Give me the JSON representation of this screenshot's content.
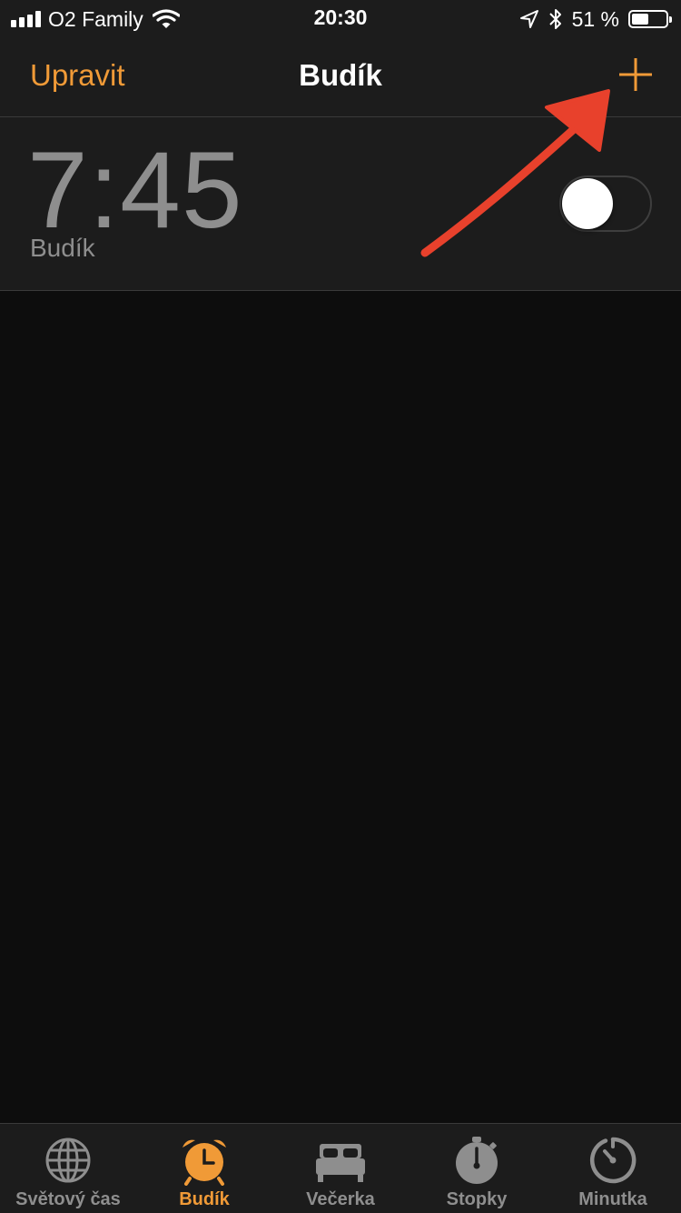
{
  "status_bar": {
    "carrier": "O2 Family",
    "time": "20:30",
    "battery_percent": "51 %",
    "battery_level": 0.51,
    "icons": [
      "signal-icon",
      "wifi-icon",
      "location-icon",
      "bluetooth-icon",
      "battery-icon"
    ]
  },
  "nav": {
    "edit_label": "Upravit",
    "title": "Budík",
    "add_icon": "plus-icon"
  },
  "alarm": {
    "time": "7:45",
    "label": "Budík",
    "enabled": false
  },
  "annotation": {
    "color": "#e8412c",
    "shape": "arrow"
  },
  "tabs": [
    {
      "label": "Světový čas",
      "icon": "globe-icon",
      "active": false
    },
    {
      "label": "Budík",
      "icon": "alarm-clock-icon",
      "active": true
    },
    {
      "label": "Večerka",
      "icon": "bed-icon",
      "active": false
    },
    {
      "label": "Stopky",
      "icon": "stopwatch-icon",
      "active": false
    },
    {
      "label": "Minutka",
      "icon": "timer-icon",
      "active": false
    }
  ],
  "colors": {
    "accent": "#f09a37",
    "background": "#0d0d0d",
    "bar_background": "#1c1c1c",
    "secondary_text": "#8e8e8e"
  }
}
